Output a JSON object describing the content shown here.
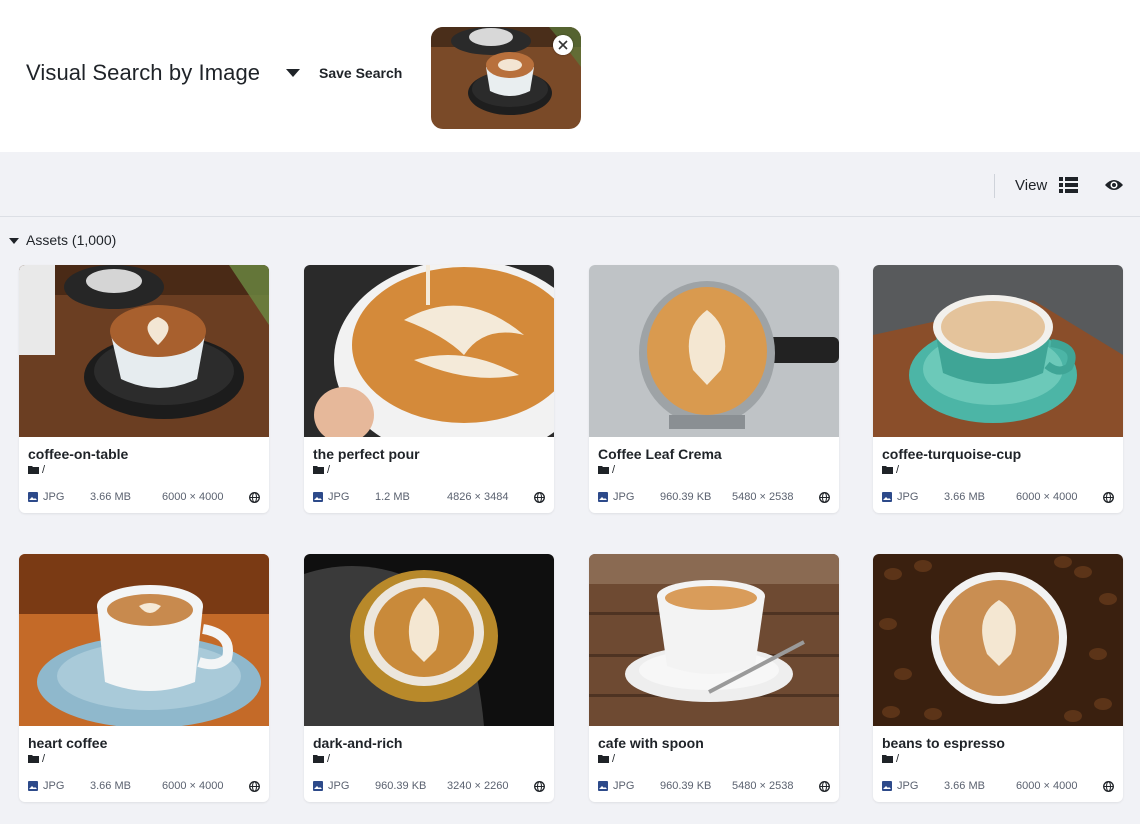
{
  "header": {
    "search_title": "Visual Search by Image",
    "save_label": "Save Search",
    "thumbnail_icon": "coffee-cup-photo"
  },
  "toolbar": {
    "view_label": "View",
    "view_icon": "list-view-icon",
    "eye_icon": "eye-icon"
  },
  "assets": {
    "heading": "Assets (1,000)",
    "folder_path": "/",
    "cards": [
      {
        "title": "coffee-on-table",
        "type": "JPG",
        "size": "3.66 MB",
        "dimensions": "6000 × 4000"
      },
      {
        "title": "the perfect pour",
        "type": "JPG",
        "size": "1.2 MB",
        "dimensions": "4826 × 3484"
      },
      {
        "title": "Coffee Leaf Crema",
        "type": "JPG",
        "size": "960.39 KB",
        "dimensions": "5480 × 2538"
      },
      {
        "title": "coffee-turquoise-cup",
        "type": "JPG",
        "size": "3.66 MB",
        "dimensions": "6000 × 4000"
      },
      {
        "title": "heart coffee",
        "type": "JPG",
        "size": "3.66 MB",
        "dimensions": "6000 × 4000"
      },
      {
        "title": "dark-and-rich",
        "type": "JPG",
        "size": "960.39 KB",
        "dimensions": "3240 × 2260"
      },
      {
        "title": "cafe with spoon",
        "type": "JPG",
        "size": "960.39 KB",
        "dimensions": "5480 × 2538"
      },
      {
        "title": "beans to espresso",
        "type": "JPG",
        "size": "3.66 MB",
        "dimensions": "6000 × 4000"
      }
    ]
  },
  "colors": {
    "background": "#f1f2f6",
    "card": "#ffffff",
    "text": "#1f2328",
    "meta_text": "#5b6270",
    "file_icon": "#2d4a8a"
  }
}
